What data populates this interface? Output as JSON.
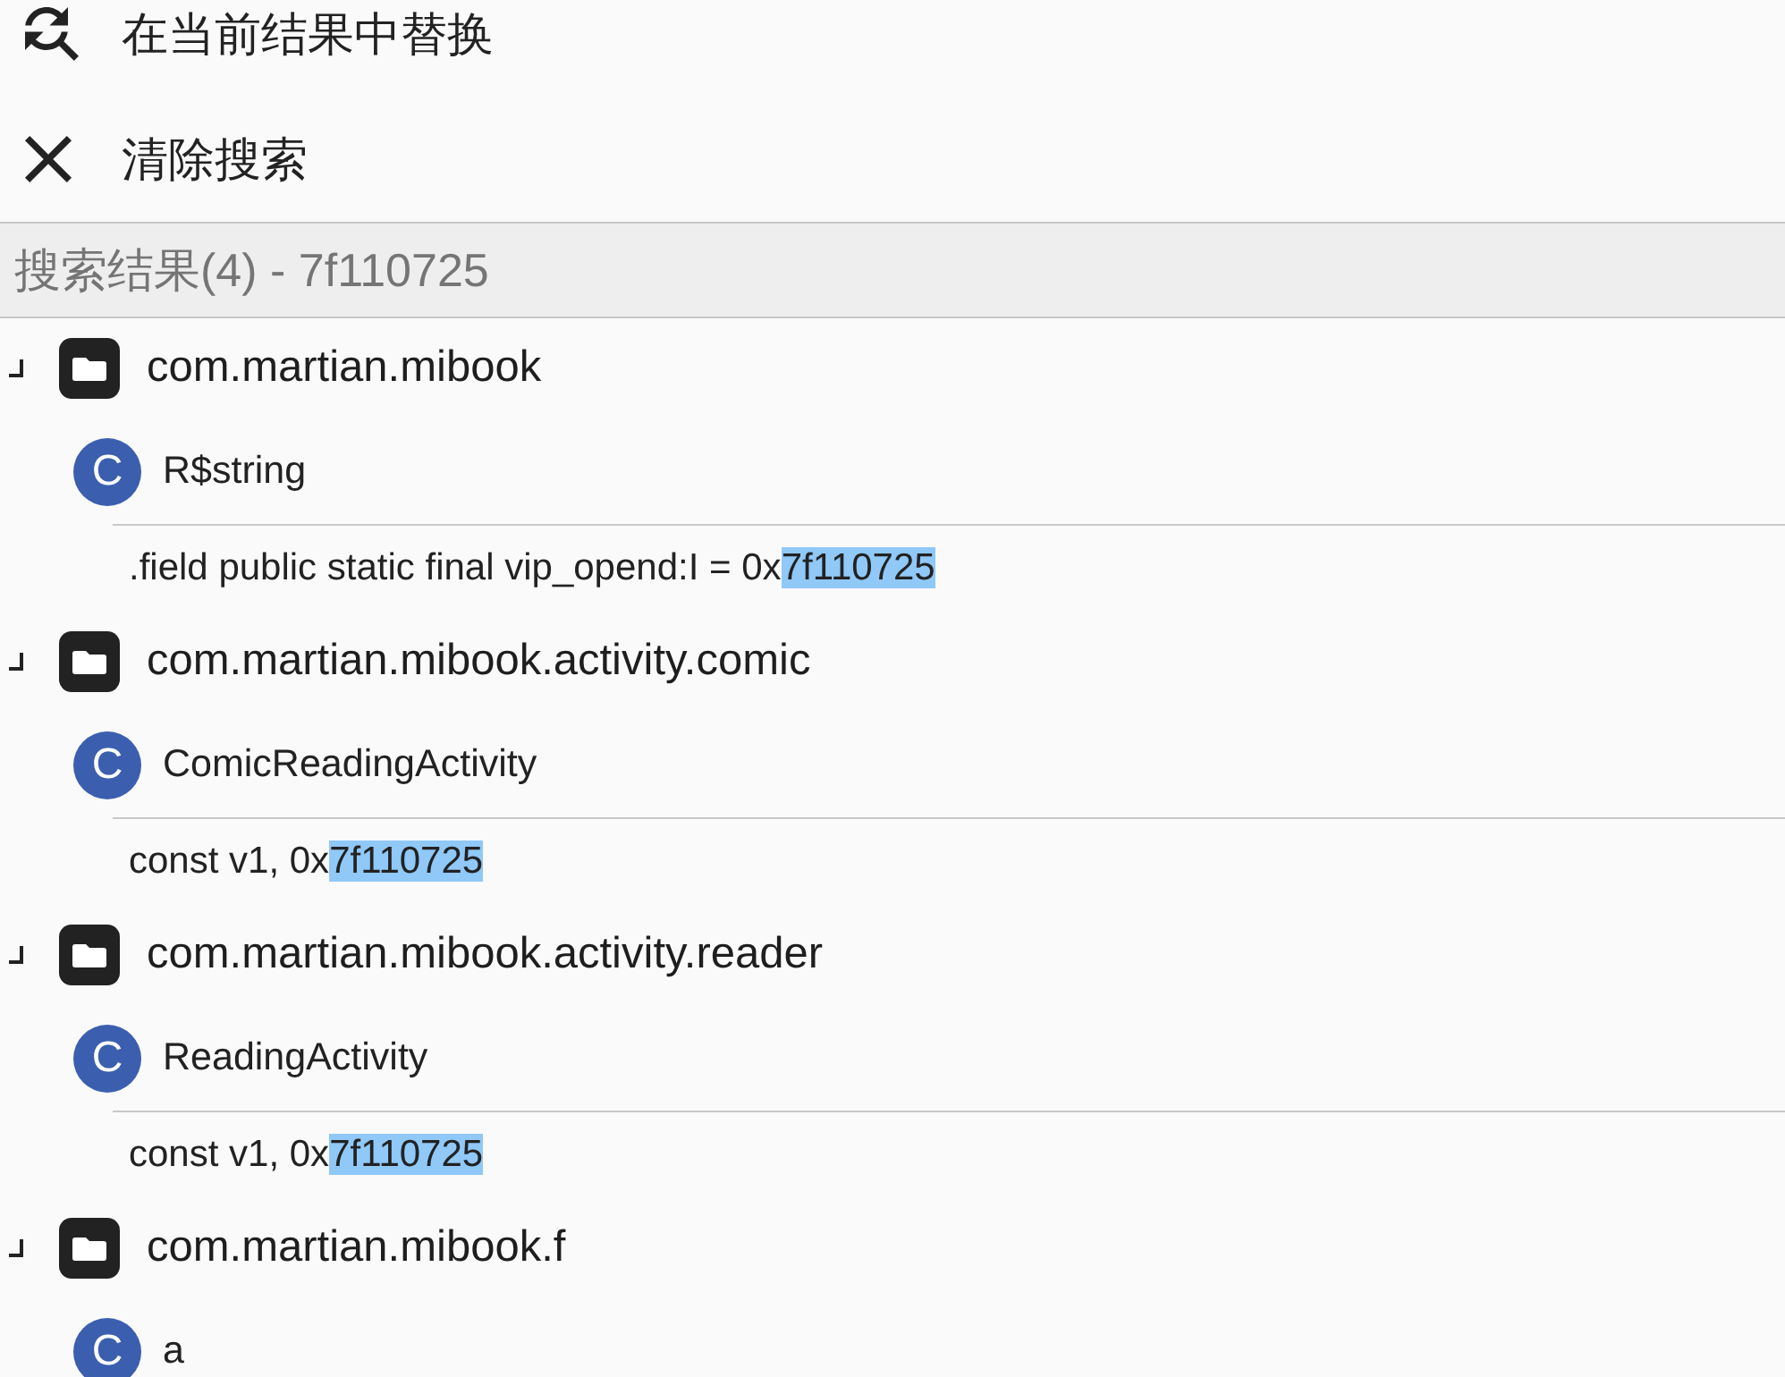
{
  "menu": [
    {
      "kind": "find-replace",
      "label": "在当前结果中替换"
    },
    {
      "kind": "clear",
      "label": "清除搜索"
    }
  ],
  "results_header": {
    "title": "搜索结果(4) - 7f110725"
  },
  "results": [
    {
      "label": "com.martian.mibook",
      "expanded": true,
      "children": [
        {
          "badge": "C",
          "label": "R$string",
          "children": [
            {
              "text": ".field public static final vip_opend:I = 0x",
              "highlight": "7f110725"
            }
          ]
        }
      ]
    },
    {
      "label": "com.martian.mibook.activity.comic",
      "expanded": true,
      "children": [
        {
          "badge": "C",
          "label": "ComicReadingActivity",
          "children": [
            {
              "text": "const v1, 0x",
              "highlight": "7f110725"
            }
          ]
        }
      ]
    },
    {
      "label": "com.martian.mibook.activity.reader",
      "expanded": true,
      "children": [
        {
          "badge": "C",
          "label": "ReadingActivity",
          "children": [
            {
              "text": "const v1, 0x",
              "highlight": "7f110725"
            }
          ]
        }
      ]
    },
    {
      "label": "com.martian.mibook.f",
      "expanded": true,
      "children": [
        {
          "badge": "C",
          "label": "a"
        }
      ]
    }
  ]
}
